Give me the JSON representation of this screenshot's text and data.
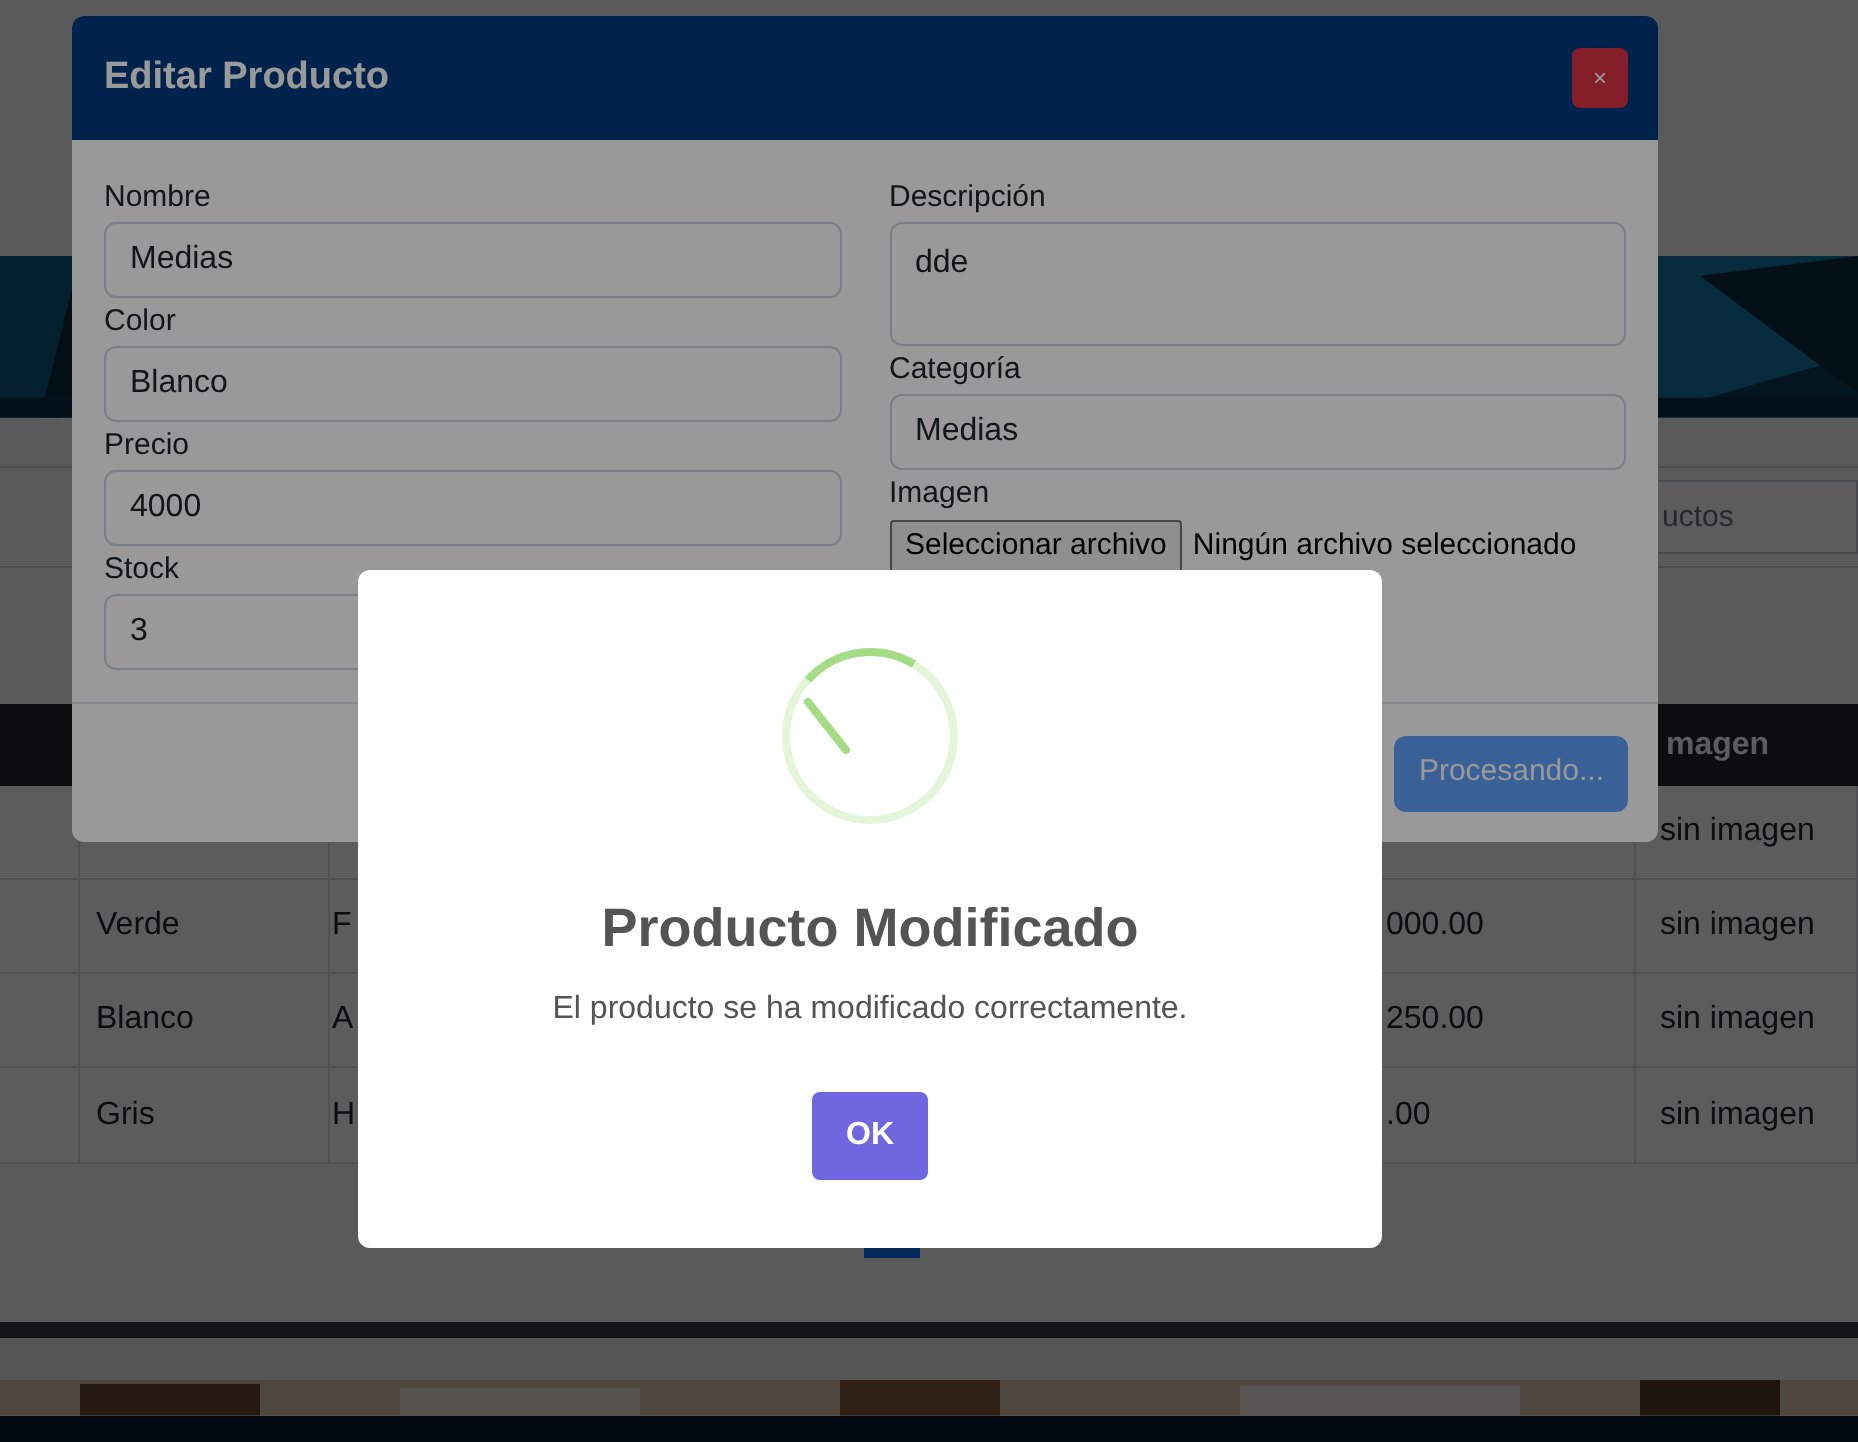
{
  "page": {
    "search": {
      "placeholder": "uctos"
    },
    "table": {
      "columns": {
        "column_5": "magen"
      },
      "rows": [
        {
          "column_5": "sin imagen"
        },
        {
          "column_2": "Verde",
          "column_3": "F",
          "column_4": "000.00",
          "column_5": "sin imagen"
        },
        {
          "column_2": "Blanco",
          "column_3": "A",
          "column_4": "250.00",
          "column_5": "sin imagen"
        },
        {
          "column_2": "Gris",
          "column_3": "H",
          "column_4": ".00",
          "column_5": "sin imagen"
        }
      ]
    }
  },
  "edit_modal": {
    "title": "Editar Producto",
    "close": "×",
    "left_fields": [
      {
        "label": "Nombre",
        "value": "Medias"
      },
      {
        "label": "Color",
        "value": "Blanco"
      },
      {
        "label": "Precio",
        "value": "4000"
      },
      {
        "label": "Stock",
        "value": "3"
      }
    ],
    "right_fields": [
      {
        "kind": "textarea",
        "label": "Descripción",
        "value": "dde"
      },
      {
        "kind": "input",
        "label": "Categoría",
        "value": "Medias"
      },
      {
        "kind": "file",
        "label": "Imagen",
        "button": "Seleccionar archivo",
        "status": "Ningún archivo seleccionado"
      }
    ],
    "submit": {
      "label": "Procesando...",
      "disabled": true
    }
  },
  "alert": {
    "title": "Producto Modificado",
    "text": "El producto se ha modificado correctamente.",
    "confirm": "OK"
  }
}
